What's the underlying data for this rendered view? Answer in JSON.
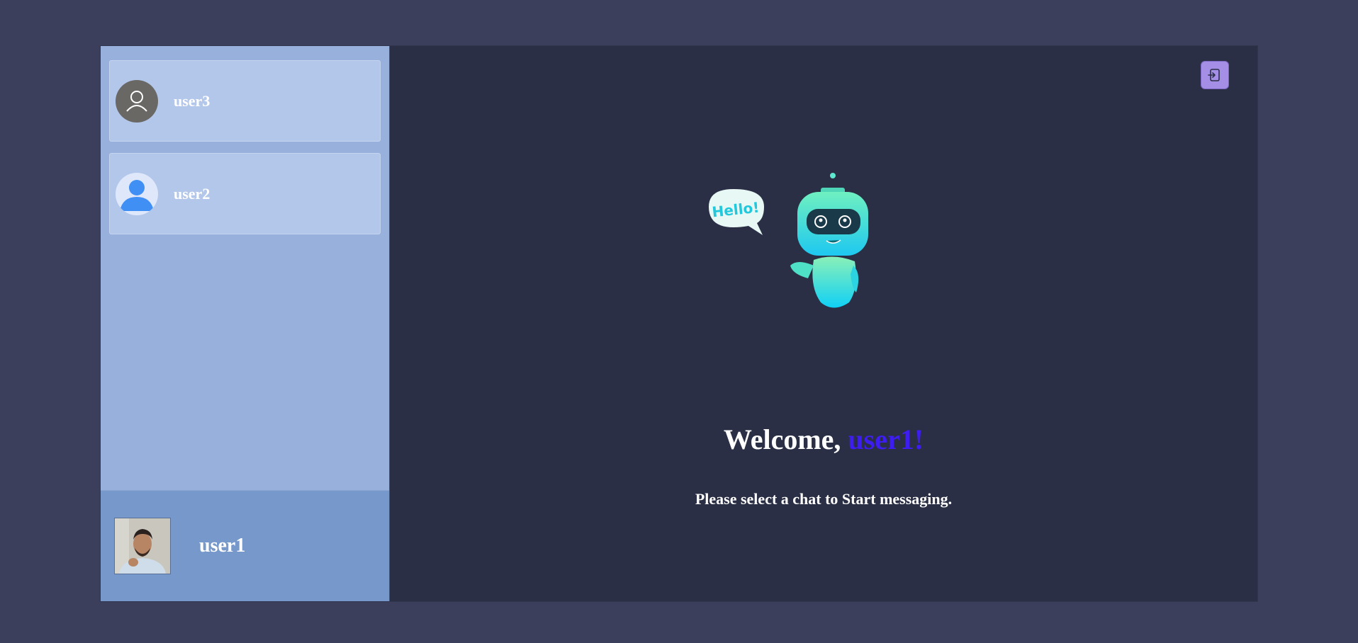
{
  "chats": [
    {
      "name": "user3",
      "avatar_icon": "default-user-outline-icon"
    },
    {
      "name": "user2",
      "avatar_icon": "default-user-filled-icon"
    }
  ],
  "current_user": {
    "name": "user1",
    "avatar": "profile-photo"
  },
  "welcome": {
    "prefix": "Welcome,",
    "username": "user1!"
  },
  "subtitle": "Please select a chat to Start messaging.",
  "robot": {
    "speech": "Hello!"
  },
  "colors": {
    "page_bg": "#3b3f5c",
    "sidebar_bg": "#97b0dc",
    "chat_item_bg": "#b3c7ea",
    "current_user_bg": "#7798ca",
    "main_bg": "#2a2f45",
    "accent": "#3d1df0",
    "logout_button": "#a58ee6"
  },
  "logout_icon": "logout-icon"
}
